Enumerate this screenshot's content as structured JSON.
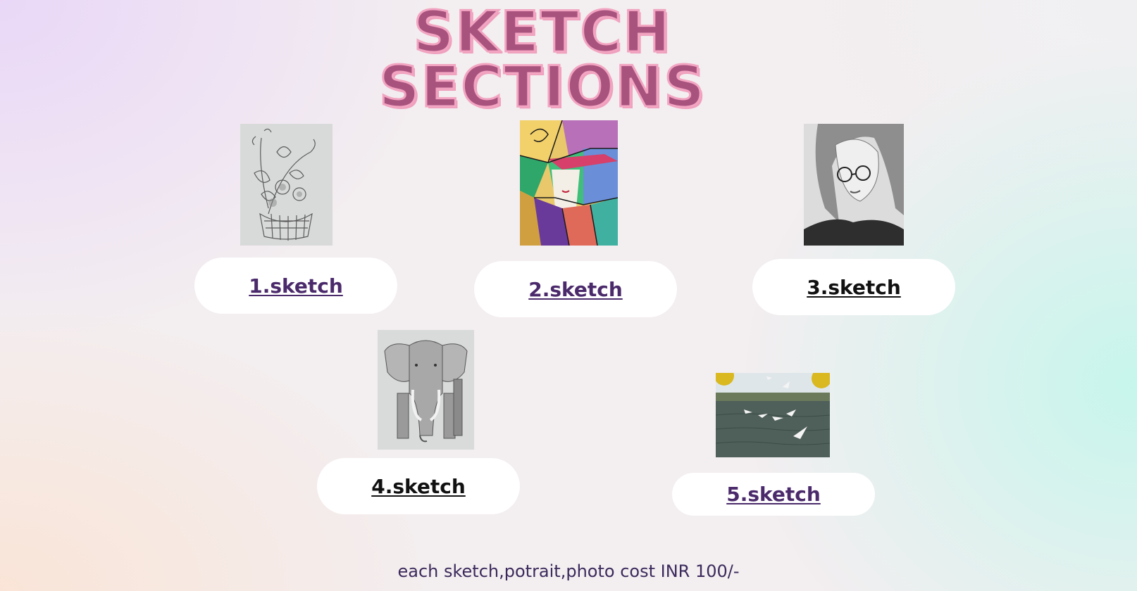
{
  "title": {
    "line1": "SKETCH",
    "line2": "SECTIONS"
  },
  "items": [
    {
      "label": "1.sketch",
      "image": "flower-basket-sketch"
    },
    {
      "label": "2.sketch",
      "image": "cubist-woman-painting"
    },
    {
      "label": "3.sketch",
      "image": "girl-with-glasses-portrait"
    },
    {
      "label": "4.sketch",
      "image": "elephant-sketch"
    },
    {
      "label": "5.sketch",
      "image": "seagulls-on-river-photo"
    }
  ],
  "footer": "each sketch,potrait,photo cost INR 100/-",
  "colors": {
    "title_fill": "#a8527e",
    "title_outline": "#f2a4c0",
    "visited_link": "#4b2a6b",
    "unvisited_link": "#111111",
    "pill_bg": "#ffffff",
    "footer_text": "#3b2a5c"
  }
}
